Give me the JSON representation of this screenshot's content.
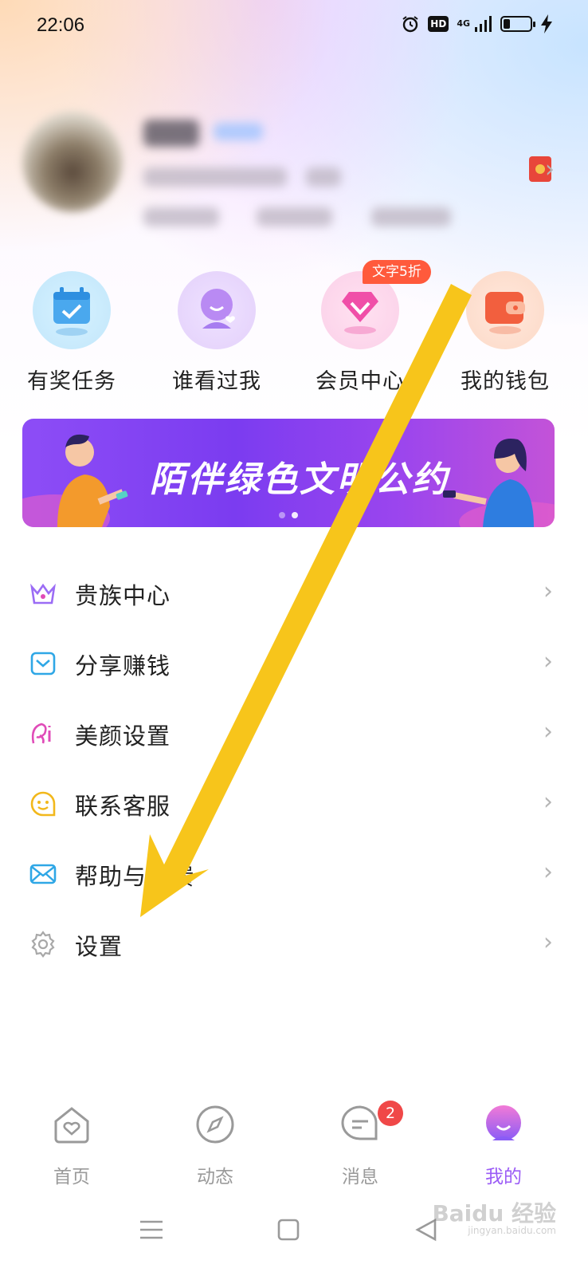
{
  "status_bar": {
    "time": "22:06",
    "network": "4G",
    "hd": "HD"
  },
  "quick_actions": [
    {
      "label": "有奖任务",
      "icon": "calendar-check-icon"
    },
    {
      "label": "谁看过我",
      "icon": "visitor-icon"
    },
    {
      "label": "会员中心",
      "icon": "diamond-icon"
    },
    {
      "label": "我的钱包",
      "icon": "wallet-icon"
    }
  ],
  "vip_tag": "文字5折",
  "banner": {
    "text": "陌伴绿色文明公约",
    "page_count": 2,
    "active_page": 2
  },
  "menu": [
    {
      "label": "贵族中心",
      "icon": "crown-icon",
      "color": "#9b6cf5"
    },
    {
      "label": "分享赚钱",
      "icon": "share-envelope-icon",
      "color": "#2fa7e6"
    },
    {
      "label": "美颜设置",
      "icon": "beauty-icon",
      "color": "#e04bb8"
    },
    {
      "label": "联系客服",
      "icon": "smile-chat-icon",
      "color": "#f2b81c"
    },
    {
      "label": "帮助与反馈",
      "icon": "mail-icon",
      "color": "#2fa7e6"
    },
    {
      "label": "设置",
      "icon": "gear-icon",
      "color": "#9a9a9a"
    }
  ],
  "tabbar": [
    {
      "label": "首页",
      "icon": "home-heart-icon",
      "active": false
    },
    {
      "label": "动态",
      "icon": "compass-icon",
      "active": false
    },
    {
      "label": "消息",
      "icon": "chat-bubble-icon",
      "active": false,
      "badge": "2"
    },
    {
      "label": "我的",
      "icon": "profile-avatar-icon",
      "active": true
    }
  ],
  "colors": {
    "accent": "#9b5cf6",
    "annotation_arrow": "#f7c51b"
  },
  "watermark": {
    "text": "Baidu 经验",
    "sub": "jingyan.baidu.com"
  }
}
